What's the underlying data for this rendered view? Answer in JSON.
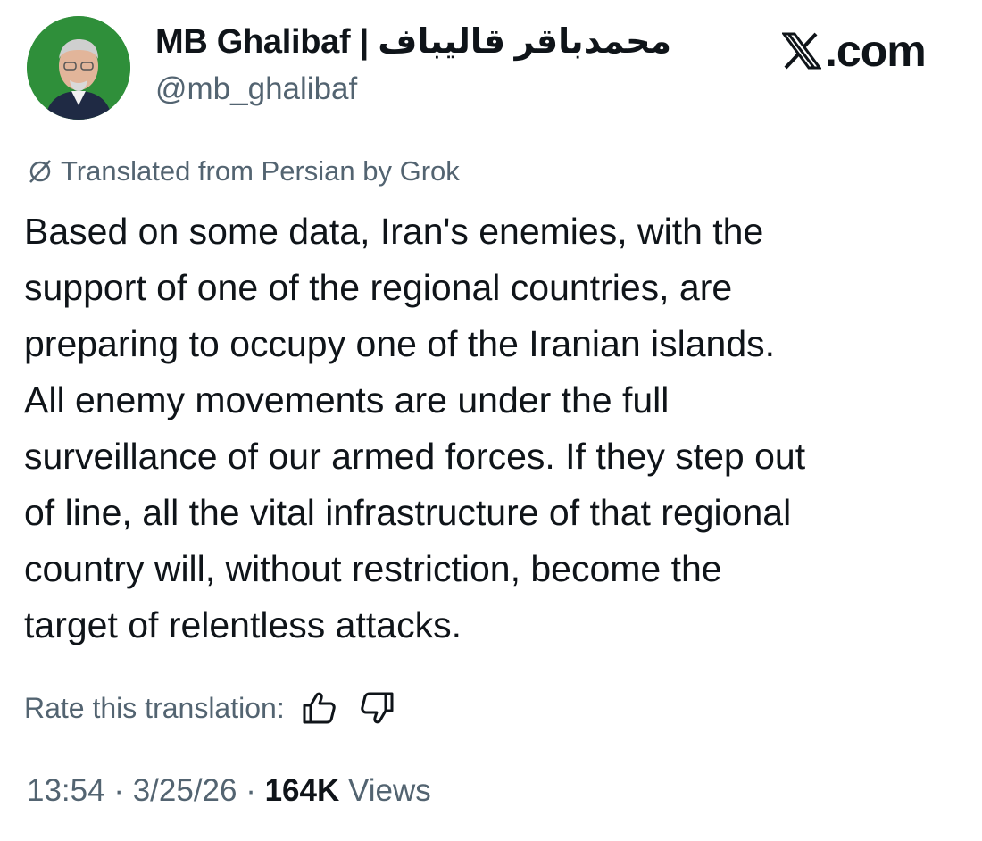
{
  "author": {
    "display_name": "MB Ghalibaf | محمدباقر قالیباف",
    "handle": "@mb_ghalibaf",
    "avatar": "profile-photo"
  },
  "site": {
    "label": ".com",
    "logo_icon": "x-logo-icon"
  },
  "translation": {
    "notice": "Translated from Persian by Grok",
    "icon": "grok-icon",
    "rate_label": "Rate this translation:",
    "thumbs_up_icon": "thumbs-up-icon",
    "thumbs_down_icon": "thumbs-down-icon"
  },
  "tweet": {
    "lines": [
      "Based on some data, Iran's enemies, with the",
      "support of one of the regional countries, are",
      "preparing to occupy one of the Iranian islands.",
      "All enemy movements are under the full",
      "surveillance of our armed forces. If they step out",
      "of line, all the vital infrastructure of that regional",
      "country will, without restriction, become the",
      "target of relentless attacks."
    ]
  },
  "meta": {
    "time": "13:54",
    "separator": " · ",
    "date": "3/25/26",
    "views_count": "164K",
    "views_label": " Views"
  },
  "colors": {
    "text": "#0f1419",
    "secondary": "#536471",
    "avatar_background": "#2f8f3a"
  }
}
